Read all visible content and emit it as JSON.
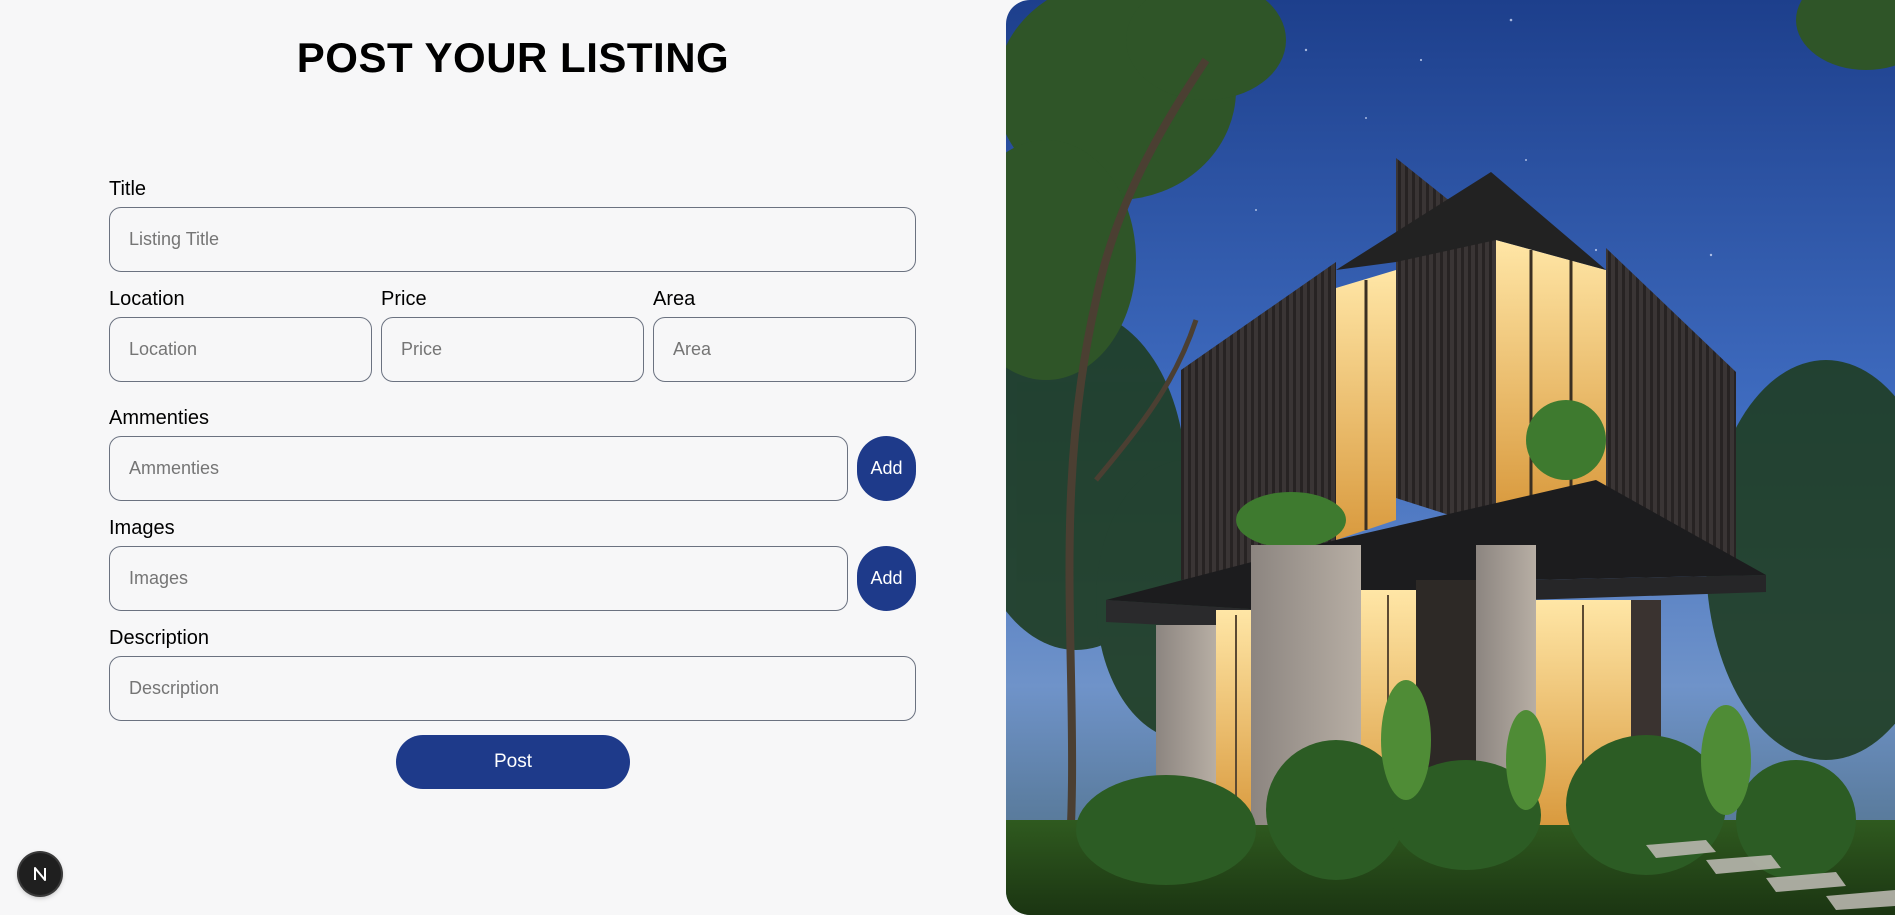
{
  "page": {
    "heading": "POST YOUR LISTING"
  },
  "form": {
    "title": {
      "label": "Title",
      "placeholder": "Listing Title"
    },
    "location": {
      "label": "Location",
      "placeholder": "Location"
    },
    "price": {
      "label": "Price",
      "placeholder": "Price"
    },
    "area": {
      "label": "Area",
      "placeholder": "Area"
    },
    "amenities": {
      "label": "Ammenties",
      "placeholder": "Ammenties",
      "add_label": "Add"
    },
    "images": {
      "label": "Images",
      "placeholder": "Images",
      "add_label": "Add"
    },
    "description": {
      "label": "Description",
      "placeholder": "Description"
    },
    "submit_label": "Post"
  },
  "badge": {
    "letter": "N",
    "icon": "nextjs-logo-icon"
  },
  "hero": {
    "image": "modern-house-at-dusk-image"
  },
  "colors": {
    "accent": "#1e3a8a",
    "background": "#f7f7f8",
    "field_border": "#6b7280"
  }
}
